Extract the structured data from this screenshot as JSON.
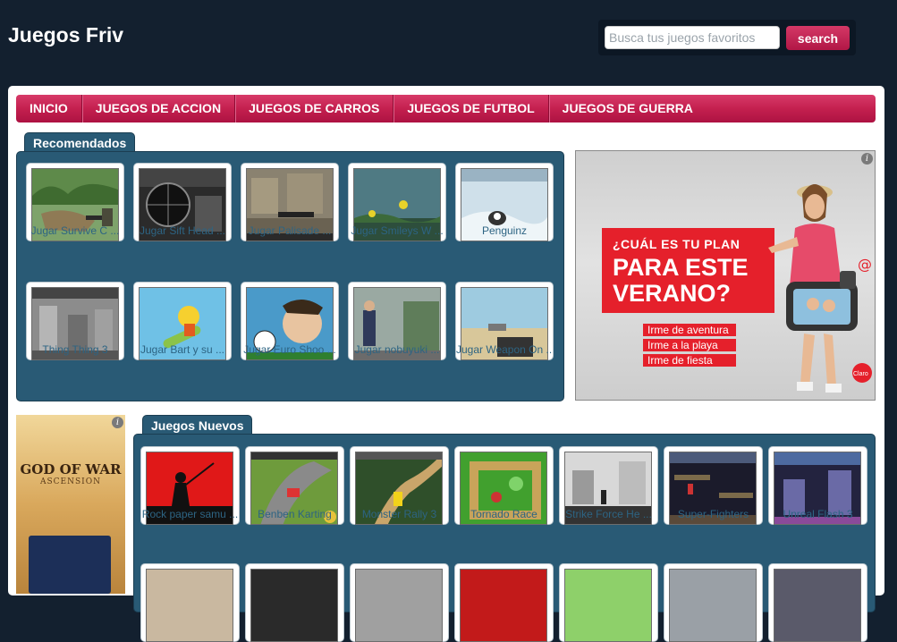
{
  "site": {
    "title": "Juegos Friv"
  },
  "search": {
    "placeholder": "Busca tus juegos favoritos",
    "value": "",
    "button_label": "search"
  },
  "nav": {
    "items": [
      {
        "label": "INICIO"
      },
      {
        "label": "JUEGOS DE ACCION"
      },
      {
        "label": "JUEGOS DE CARROS"
      },
      {
        "label": "JUEGOS DE FUTBOL"
      },
      {
        "label": "JUEGOS DE GUERRA"
      }
    ]
  },
  "recomendados": {
    "heading": "Recomendados",
    "games": [
      {
        "title": "Jugar Survive C ...",
        "thumb": "jungle-soldier"
      },
      {
        "title": "Jugar Sift Head ...",
        "thumb": "sniper-scope"
      },
      {
        "title": "Jugar Palisade ...",
        "thumb": "city-shooter"
      },
      {
        "title": "Jugar Smileys W ...",
        "thumb": "smiley-war"
      },
      {
        "title": "Penguinz",
        "thumb": "penguin-ice"
      },
      {
        "title": "Thing Thing 3",
        "thumb": "thing-thing"
      },
      {
        "title": "Jugar Bart y su ...",
        "thumb": "bart-skate"
      },
      {
        "title": "Jugar Euro Shoo ...",
        "thumb": "euro-shoot"
      },
      {
        "title": "Jugar nobuyuki ...",
        "thumb": "nobuyuki"
      },
      {
        "title": "Jugar Weapon On ...",
        "thumb": "desert-gun"
      }
    ]
  },
  "ad_top": {
    "headline1": "¿CUÁL ES TU PLAN",
    "headline2": "PARA ESTE",
    "headline3": "VERANO?",
    "options": [
      "Irme de aventura",
      "Irme a la playa",
      "Irme de fiesta"
    ],
    "brand": "Claro"
  },
  "ad_side": {
    "title1": "GOD OF WAR",
    "title2": "ASCENSION"
  },
  "nuevos": {
    "heading": "Juegos Nuevos",
    "games": [
      {
        "title": "Rock paper samu ...",
        "thumb": "samurai"
      },
      {
        "title": "Benben Karting",
        "thumb": "karting"
      },
      {
        "title": "Monster Rally 3",
        "thumb": "rally"
      },
      {
        "title": "Tornado Race",
        "thumb": "tornado"
      },
      {
        "title": "Strike Force He ...",
        "thumb": "strike-force"
      },
      {
        "title": "Super-Fighters",
        "thumb": "super-fighters"
      },
      {
        "title": "Unreal Flash 3",
        "thumb": "unreal-flash"
      }
    ]
  },
  "colors": {
    "nav": "#c4204f",
    "panel": "#295a75",
    "background": "#13202f",
    "link": "#2d6483"
  }
}
